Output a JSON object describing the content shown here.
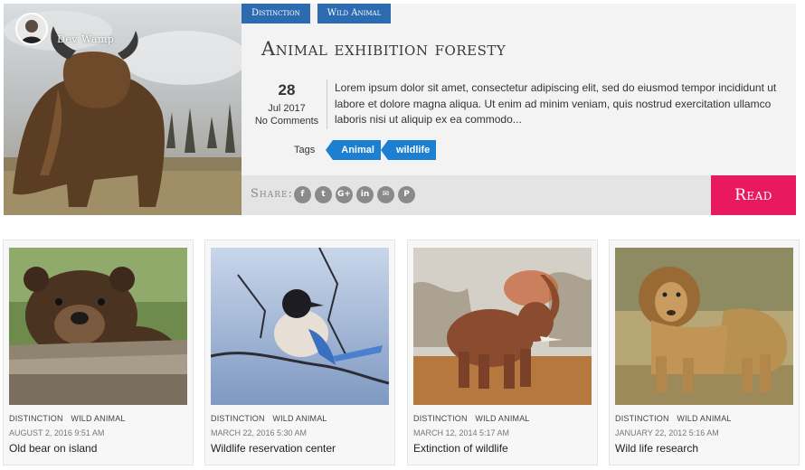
{
  "featured": {
    "author_name": "Dev Wamp",
    "categories": [
      "Distinction",
      "Wild Animal"
    ],
    "title": "Animal exhibition foresty",
    "date": {
      "day": "28",
      "month_year": "Jul 2017",
      "comments": "No Comments"
    },
    "excerpt": "Lorem ipsum dolor sit amet, consectetur adipiscing elit, sed do eiusmod tempor incididunt ut labore et dolore magna aliqua. Ut enim ad minim veniam, quis nostrud exercitation ullamco laboris nisi ut aliquip ex ea commodo...",
    "tags_label": "Tags",
    "tags": [
      "Animal",
      "wildlife"
    ],
    "share_label": "Share:",
    "share_icons": [
      {
        "name": "facebook-icon",
        "glyph": "f"
      },
      {
        "name": "twitter-icon",
        "glyph": "t"
      },
      {
        "name": "google-plus-icon",
        "glyph": "G+"
      },
      {
        "name": "linkedin-icon",
        "glyph": "in"
      },
      {
        "name": "email-icon",
        "glyph": "✉"
      },
      {
        "name": "pinterest-icon",
        "glyph": "P"
      }
    ],
    "read_more": "Read More"
  },
  "cards": [
    {
      "category": "DISTINCTION",
      "category2": "WILD ANIMAL",
      "date": "AUGUST 2, 2016 9:51 AM",
      "title": "Old bear on island"
    },
    {
      "category": "DISTINCTION",
      "category2": "WILD ANIMAL",
      "date": "MARCH 22, 2016 5:30 AM",
      "title": "Wildlife reservation center"
    },
    {
      "category": "DISTINCTION",
      "category2": "WILD ANIMAL",
      "date": "MARCH 12, 2014 5:17 AM",
      "title": "Extinction of wildlife"
    },
    {
      "category": "DISTINCTION",
      "category2": "WILD ANIMAL",
      "date": "JANUARY 22, 2012 5:16 AM",
      "title": "Wild life research"
    }
  ],
  "colors": {
    "category_blue": "#2d6bb1",
    "tag_blue": "#1c7fd1",
    "read_more_pink": "#e8195f",
    "share_gray": "#8a8a8a"
  }
}
